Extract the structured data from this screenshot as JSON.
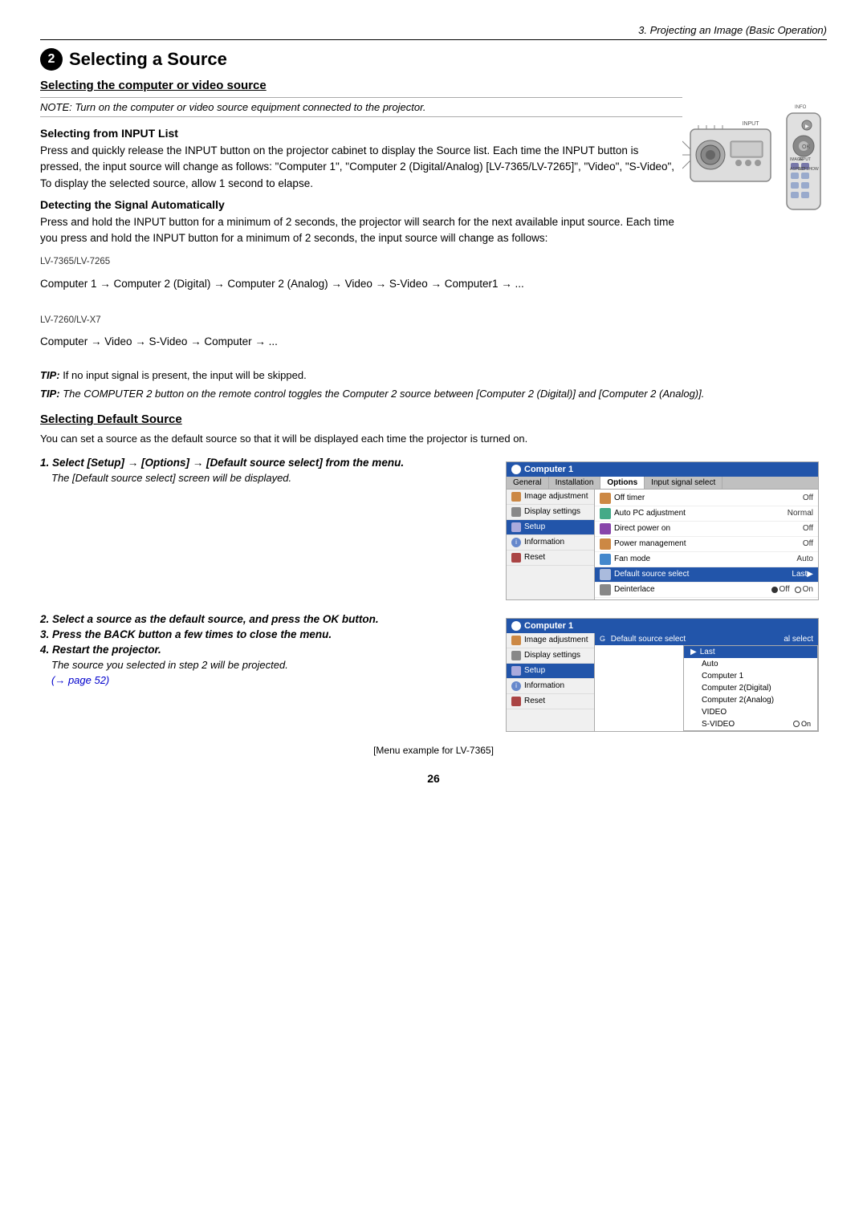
{
  "page": {
    "header": "3. Projecting an Image (Basic Operation)",
    "section_num": "2",
    "section_title": "Selecting a Source",
    "subsection_title": "Selecting the computer or video source",
    "note": "NOTE: Turn on the computer or video source equipment connected to the projector.",
    "from_input_heading": "Selecting from INPUT List",
    "from_input_text": "Press and quickly release the INPUT button on the projector cabinet to display the Source list. Each time the INPUT button is pressed, the input source will change as follows: \"Computer 1\", \"Computer 2 (Digital/Analog) [LV-7365/LV-7265]\", \"Video\", \"S-Video\", To display the selected source, allow 1 second to elapse.",
    "detecting_heading": "Detecting the Signal Automatically",
    "detecting_text": "Press and hold the INPUT button for a minimum of 2 seconds, the projector will search for the next available input source. Each time you press and hold the INPUT button for a minimum of 2 seconds, the input source will change as follows:",
    "lv_7365_label": "LV-7365/LV-7265",
    "lv_7365_flow": "Computer 1 → Computer 2 (Digital) → Computer 2 (Analog) → Video → S-Video → Computer1 → ...",
    "lv_7260_label": "LV-7260/LV-X7",
    "lv_7260_flow": "Computer → Video → S-Video → Computer → ...",
    "tip1": "TIP: If no input signal is present, the input will be skipped.",
    "tip2": "TIP: The COMPUTER 2 button on the remote control toggles the Computer 2 source between [Computer 2 (Digital)] and [Computer 2 (Analog)].",
    "default_source_heading": "Selecting Default Source",
    "default_source_text": "You can set a source as the default source so that it will be displayed each time the projector is turned on.",
    "step1_label": "1. Select [Setup] → [Options] → [Default source select] from the menu.",
    "step1_desc": "The [Default source select] screen will be displayed.",
    "step2_label": "2. Select a source as the default source, and press the OK button.",
    "step3_label": "3. Press the BACK button a few times to close the menu.",
    "step4_label": "4. Restart the projector.",
    "step4_desc": "The source you selected in step 2 will be projected.",
    "step4_ref": "(→ page 52)",
    "menu_caption": "[Menu example for LV-7365]",
    "page_num": "26",
    "menu1": {
      "title": "Computer 1",
      "tabs": [
        "General",
        "Installation",
        "Options",
        "Input signal select"
      ],
      "sidebar": [
        {
          "label": "Image adjustment",
          "icon": "image-icon"
        },
        {
          "label": "Display settings",
          "icon": "display-icon"
        },
        {
          "label": "Setup",
          "icon": "setup-icon"
        },
        {
          "label": "Information",
          "icon": "info-icon"
        },
        {
          "label": "Reset",
          "icon": "reset-icon"
        }
      ],
      "active_tab": "Options",
      "active_sidebar": "Setup",
      "rows": [
        {
          "icon": "off-timer-icon",
          "label": "Off timer",
          "value": "Off"
        },
        {
          "icon": "auto-pc-icon",
          "label": "Auto PC adjustment",
          "value": "Normal"
        },
        {
          "icon": "direct-power-icon",
          "label": "Direct power on",
          "value": "Off"
        },
        {
          "icon": "power-mgmt-icon",
          "label": "Power management",
          "value": "Off"
        },
        {
          "icon": "fan-icon",
          "label": "Fan mode",
          "value": "Auto"
        },
        {
          "icon": "default-source-icon",
          "label": "Default source select",
          "value": "Last",
          "arrow": "▶",
          "highlighted": true
        },
        {
          "icon": "deinterlace-icon",
          "label": "Deinterlace",
          "value_radio": true,
          "off_selected": true
        }
      ]
    },
    "menu2": {
      "title": "Computer 1",
      "sidebar": [
        {
          "label": "Image adjustment",
          "icon": "image-icon"
        },
        {
          "label": "Display settings",
          "icon": "display-icon"
        },
        {
          "label": "Setup",
          "icon": "setup-icon"
        },
        {
          "label": "Information",
          "icon": "info-icon"
        },
        {
          "label": "Reset",
          "icon": "reset-icon"
        }
      ],
      "active_sidebar": "Setup",
      "header_row": "Default source select",
      "header_right": "al select",
      "dropdown_items": [
        {
          "label": "Last",
          "selected": true,
          "has_arrow": true
        },
        {
          "label": "Auto",
          "selected": false
        },
        {
          "label": "Computer 1",
          "selected": false
        },
        {
          "label": "Computer 2(Digital)",
          "selected": false
        },
        {
          "label": "Computer 2(Analog)",
          "selected": false
        },
        {
          "label": "VIDEO",
          "selected": false
        },
        {
          "label": "S-VIDEO",
          "selected": false,
          "has_radio": true
        }
      ]
    }
  }
}
